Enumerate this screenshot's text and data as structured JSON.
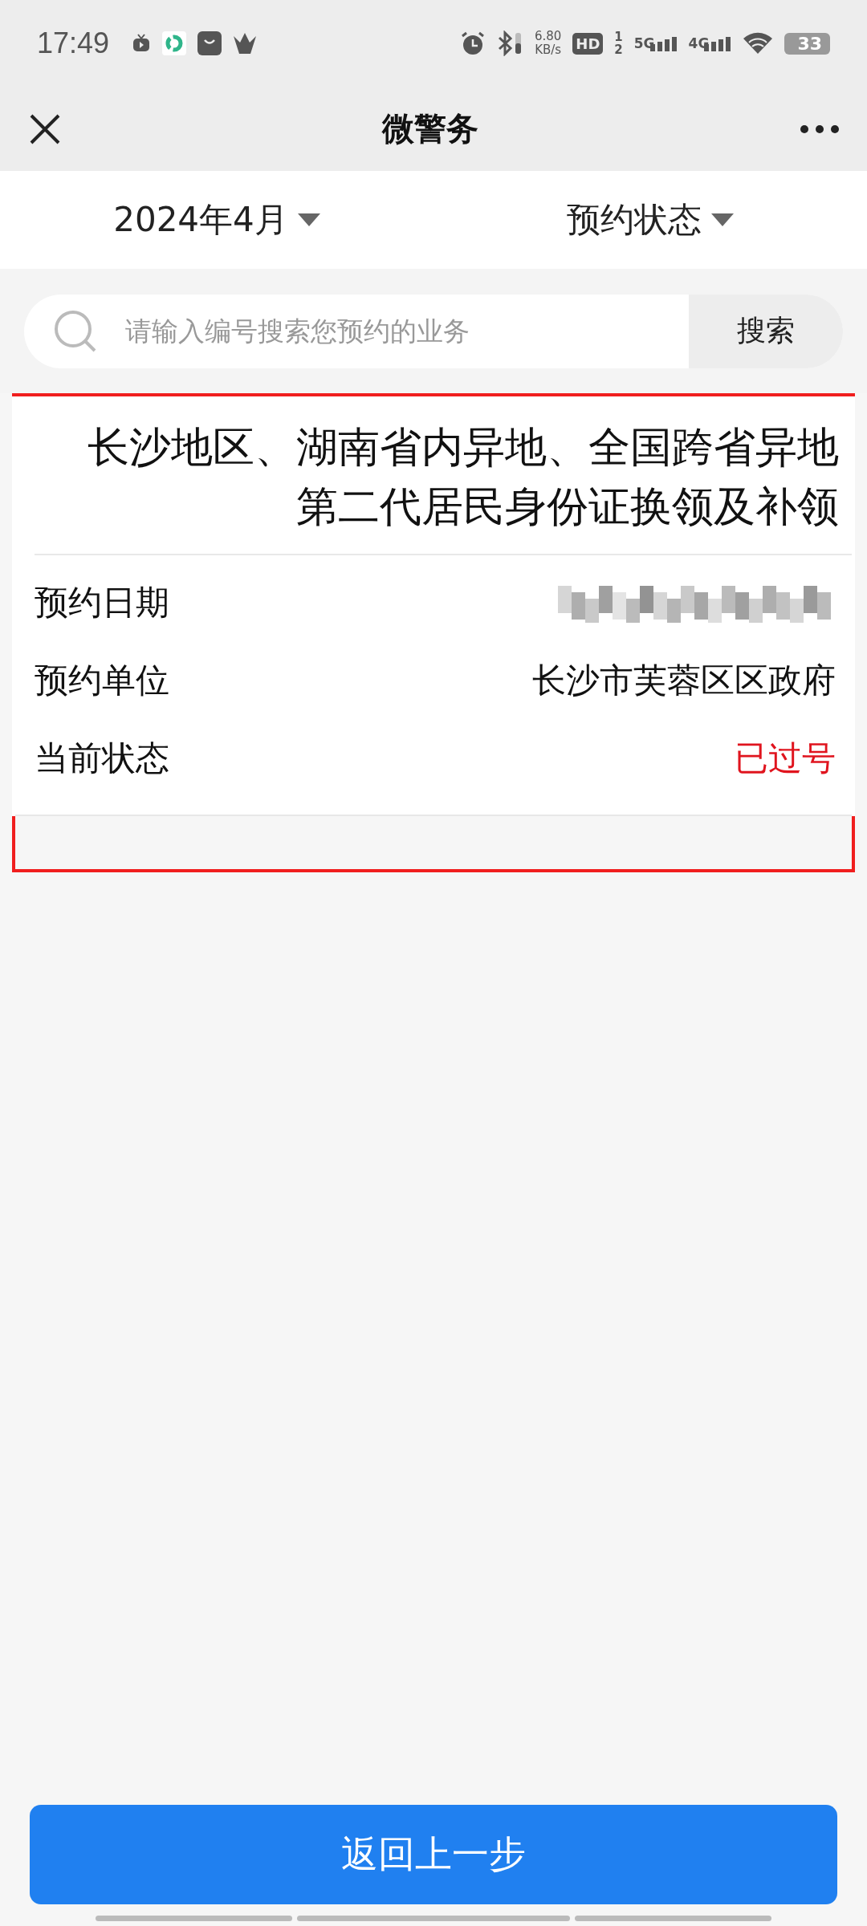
{
  "status_bar": {
    "time": "17:49",
    "speed_value": "6.80",
    "speed_unit": "KB/s",
    "hd": "HD",
    "sim_1": "1",
    "sim_2": "2",
    "network_1": "5G",
    "network_2": "4G",
    "battery": "33"
  },
  "nav": {
    "title": "微警务"
  },
  "filters": [
    {
      "label": "2024年4月"
    },
    {
      "label": "预约状态"
    }
  ],
  "search": {
    "placeholder": "请输入编号搜索您预约的业务",
    "button": "搜索"
  },
  "appointment": {
    "highlighted": true,
    "title": "长沙地区、湖南省内异地、全国跨省异地第二代居民身份证换领及补领",
    "rows": [
      {
        "label": "预约日期",
        "kind": "redacted"
      },
      {
        "label": "预约单位",
        "kind": "text",
        "value": "长沙市芙蓉区区政府"
      },
      {
        "label": "当前状态",
        "kind": "status",
        "value": "已过号",
        "color": "#e0141e"
      }
    ]
  },
  "back_button": "返回上一步"
}
